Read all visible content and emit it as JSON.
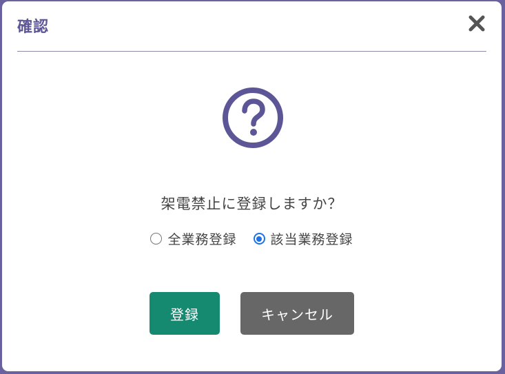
{
  "dialog": {
    "title": "確認",
    "close_icon": "close-icon",
    "question_icon": "question-circle-icon",
    "message": "架電禁止に登録しますか？",
    "options": [
      {
        "label": "全業務登録",
        "checked": false
      },
      {
        "label": "該当業務登録",
        "checked": true
      }
    ],
    "register_label": "登録",
    "cancel_label": "キャンセル"
  },
  "colors": {
    "accent": "#5c5596",
    "border": "#6a629e",
    "register_button": "#158a71",
    "cancel_button": "#676767",
    "radio_checked": "#1a73e8"
  }
}
